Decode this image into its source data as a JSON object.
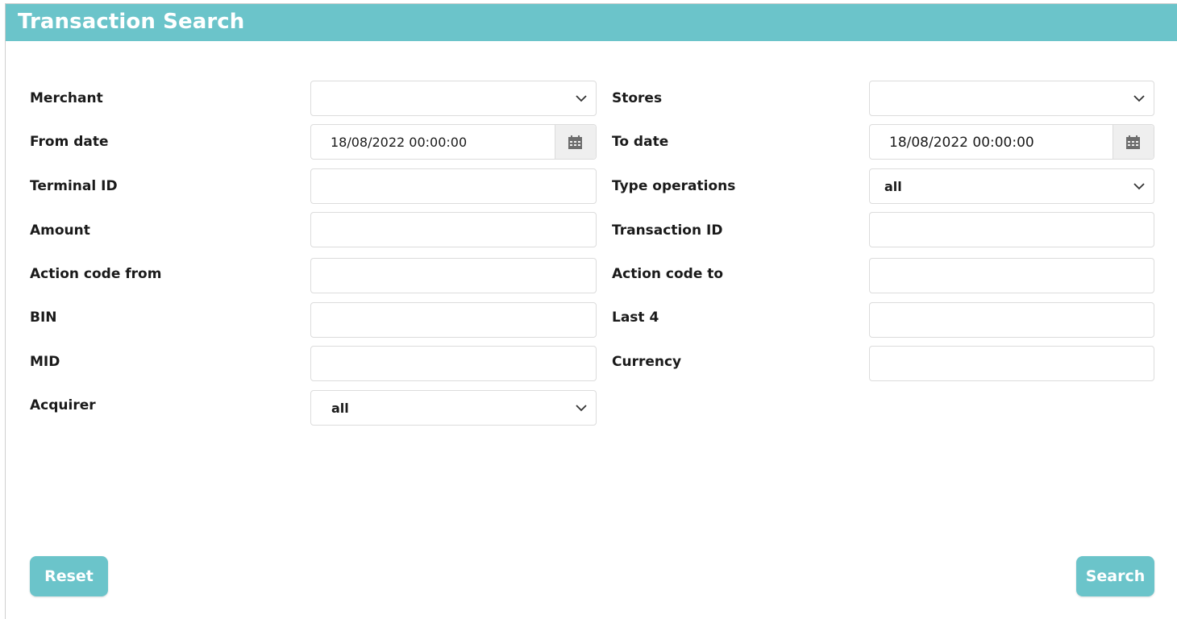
{
  "header": {
    "title": "Transaction Search"
  },
  "form": {
    "merchant": {
      "label": "Merchant",
      "value": ""
    },
    "stores": {
      "label": "Stores",
      "value": ""
    },
    "from_date": {
      "label": "From date",
      "value": "18/08/2022 00:00:00"
    },
    "to_date": {
      "label": "To date",
      "value": "18/08/2022 00:00:00"
    },
    "terminal_id": {
      "label": "Terminal ID",
      "value": ""
    },
    "type_operations": {
      "label": "Type operations",
      "value": "all"
    },
    "amount": {
      "label": "Amount",
      "value": ""
    },
    "transaction_id": {
      "label": "Transaction ID",
      "value": ""
    },
    "action_code_from": {
      "label": "Action code from",
      "value": ""
    },
    "action_code_to": {
      "label": "Action code to",
      "value": ""
    },
    "bin": {
      "label": "BIN",
      "value": ""
    },
    "last4": {
      "label": "Last 4",
      "value": ""
    },
    "mid": {
      "label": "MID",
      "value": ""
    },
    "currency": {
      "label": "Currency",
      "value": ""
    },
    "acquirer": {
      "label": "Acquirer",
      "value": "all"
    }
  },
  "buttons": {
    "reset": "Reset",
    "search": "Search"
  },
  "icons": {
    "dropdown": "chevron-down-icon",
    "calendar": "calendar-icon"
  },
  "colors": {
    "accent": "#6bc4ca"
  }
}
